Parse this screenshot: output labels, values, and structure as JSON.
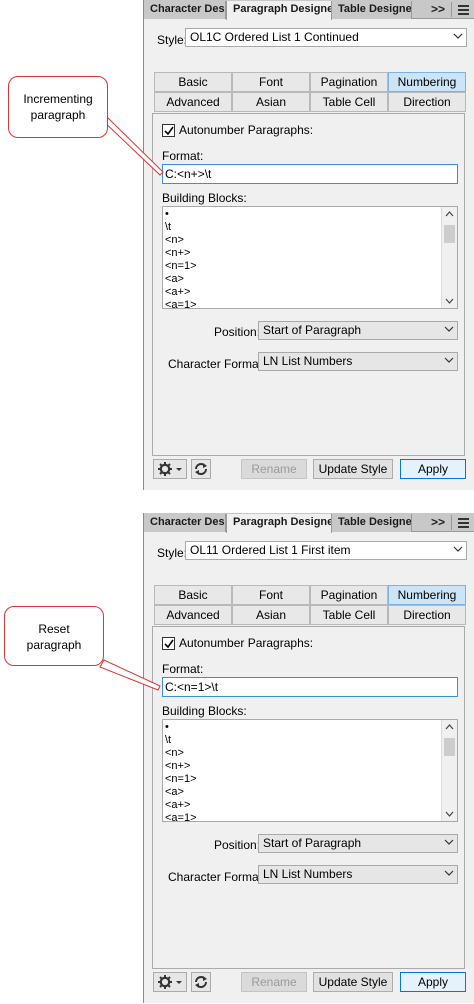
{
  "callouts": [
    {
      "line1": "Incrementing",
      "line2": "paragraph"
    },
    {
      "line1": "Reset",
      "line2": "paragraph"
    }
  ],
  "panels": [
    {
      "tabs": [
        "Character Designer",
        "Paragraph Designer",
        "Table Designer"
      ],
      "active_tab": "Paragraph Designer",
      "overflow_label": ">>",
      "style_label": "Style:",
      "style_value": "OL1C Ordered List 1 Continued",
      "prop_tabs_row1": [
        "Basic",
        "Font",
        "Pagination",
        "Numbering"
      ],
      "prop_tabs_row2": [
        "Advanced",
        "Asian",
        "Table Cell",
        "Direction"
      ],
      "active_prop_tab": "Numbering",
      "autonumber_checked": true,
      "autonumber_label": "Autonumber Paragraphs:",
      "format_label": "Format:",
      "format_value": "C:<n+>\\t",
      "building_blocks_label": "Building Blocks:",
      "building_blocks": [
        "•",
        "\\t",
        "<n>",
        "<n+>",
        "<n=1>",
        "<a>",
        "<a+>",
        "<a=1>"
      ],
      "position_label": "Position:",
      "position_value": "Start of Paragraph",
      "char_format_label": "Character Format:",
      "char_format_value": "LN List Numbers",
      "rename_label": "Rename",
      "update_style_label": "Update Style",
      "apply_label": "Apply"
    },
    {
      "tabs": [
        "Character Designer",
        "Paragraph Designer",
        "Table Designer"
      ],
      "active_tab": "Paragraph Designer",
      "overflow_label": ">>",
      "style_label": "Style:",
      "style_value": "OL11 Ordered List 1 First item",
      "prop_tabs_row1": [
        "Basic",
        "Font",
        "Pagination",
        "Numbering"
      ],
      "prop_tabs_row2": [
        "Advanced",
        "Asian",
        "Table Cell",
        "Direction"
      ],
      "active_prop_tab": "Numbering",
      "autonumber_checked": true,
      "autonumber_label": "Autonumber Paragraphs:",
      "format_label": "Format:",
      "format_value": "C:<n=1>\\t",
      "building_blocks_label": "Building Blocks:",
      "building_blocks": [
        "•",
        "\\t",
        "<n>",
        "<n+>",
        "<n=1>",
        "<a>",
        "<a+>",
        "<a=1>"
      ],
      "position_label": "Position:",
      "position_value": "Start of Paragraph",
      "char_format_label": "Character Format:",
      "char_format_value": "LN List Numbers",
      "rename_label": "Rename",
      "update_style_label": "Update Style",
      "apply_label": "Apply"
    }
  ],
  "colors": {
    "callout_border": "#dd3333",
    "active_tab": "#cce4f7",
    "focus_border": "#3c8fd6"
  }
}
